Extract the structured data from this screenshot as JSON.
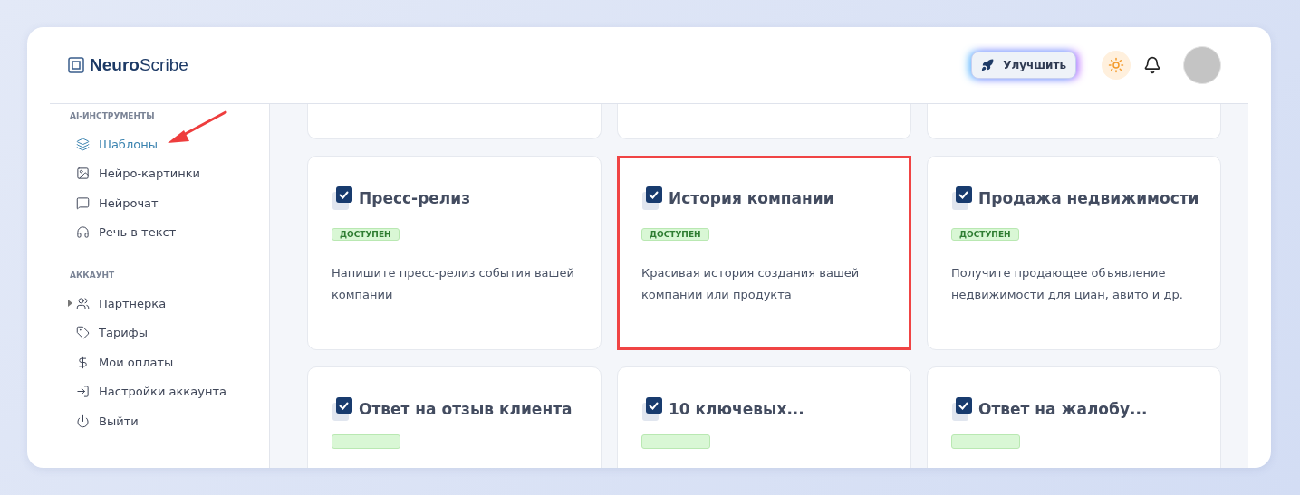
{
  "logo": {
    "bold": "Neuro",
    "light": "Scribe"
  },
  "header": {
    "upgrade_label": "Улучшить",
    "light_theme": true
  },
  "sidebar": {
    "sections": [
      {
        "title": "AI-ИНСТРУМЕНТЫ",
        "items": [
          {
            "label": "Шаблоны",
            "selected": true,
            "expandable": false
          },
          {
            "label": "Нейро-картинки",
            "selected": false,
            "expandable": false
          },
          {
            "label": "Нейрочат",
            "selected": false,
            "expandable": false
          },
          {
            "label": "Речь в текст",
            "selected": false,
            "expandable": false
          }
        ]
      },
      {
        "title": "АККАУНТ",
        "items": [
          {
            "label": "Партнерка",
            "selected": false,
            "expandable": true
          },
          {
            "label": "Тарифы",
            "selected": false,
            "expandable": false
          },
          {
            "label": "Мои оплаты",
            "selected": false,
            "expandable": false
          },
          {
            "label": "Настройки аккаунта",
            "selected": false,
            "expandable": false
          },
          {
            "label": "Выйти",
            "selected": false,
            "expandable": false
          }
        ]
      }
    ]
  },
  "annotation": {
    "arrow_to_selected": true
  },
  "cards": [
    {
      "kind": "stub"
    },
    {
      "kind": "stub"
    },
    {
      "kind": "stub"
    },
    {
      "kind": "full",
      "title": "Пресс-релиз",
      "badge": "ДОСТУПЕН",
      "description": "Напишите пресс-релиз события вашей компании",
      "highlighted": false
    },
    {
      "kind": "full",
      "title": "История компании",
      "badge": "ДОСТУПЕН",
      "description": "Красивая история создания вашей компании или продукта",
      "highlighted": true
    },
    {
      "kind": "full",
      "title": "Продажа недвижимости",
      "badge": "ДОСТУПЕН",
      "description": "Получите продающее объявление недвижимости для циан, авито и др.",
      "highlighted": false
    },
    {
      "kind": "cut",
      "title": "Ответ на отзыв клиента",
      "highlighted": false
    },
    {
      "kind": "cut",
      "title": "10 ключевых...",
      "highlighted": false
    },
    {
      "kind": "cut",
      "title": "Ответ на жалобу...",
      "highlighted": false
    }
  ]
}
